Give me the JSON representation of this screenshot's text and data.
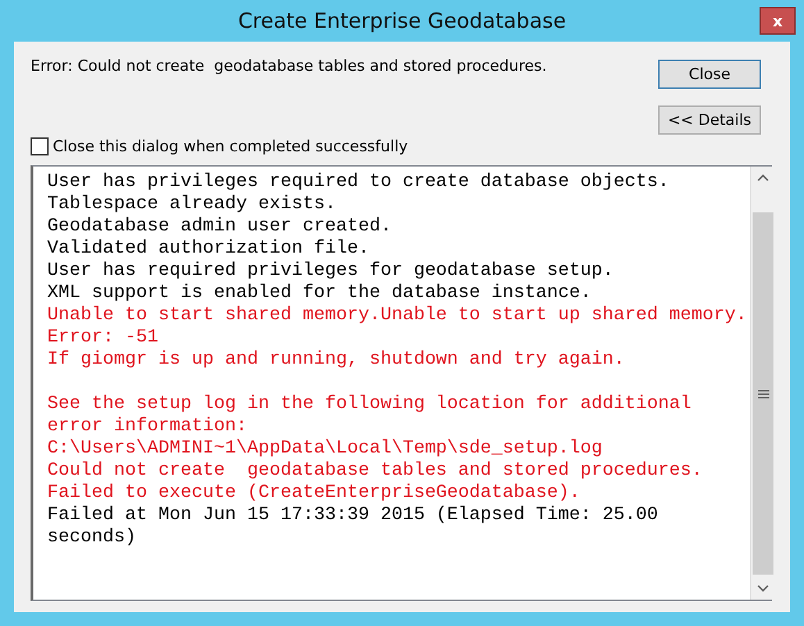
{
  "window": {
    "title": "Create Enterprise Geodatabase",
    "close_glyph": "x"
  },
  "message": "Error: Could not create  geodatabase tables and stored procedures.",
  "buttons": [
    {
      "label": "Close"
    },
    {
      "label": "<< Details"
    }
  ],
  "checkbox": {
    "label": "Close this dialog when completed successfully",
    "checked": false
  },
  "log": [
    {
      "lines": [
        {
          "kind": "info",
          "text": "User has privileges required to create database objects."
        },
        {
          "kind": "info",
          "text": "Tablespace already exists."
        },
        {
          "kind": "info",
          "text": "Geodatabase admin user created."
        },
        {
          "kind": "info",
          "text": "Validated authorization file."
        },
        {
          "kind": "info",
          "text": "User has required privileges for geodatabase setup."
        },
        {
          "kind": "info",
          "text": "XML support is enabled for the database instance."
        },
        {
          "kind": "error",
          "text": "Unable to start shared memory.Unable to start up shared memory."
        },
        {
          "kind": "error",
          "text": "Error: -51"
        },
        {
          "kind": "error",
          "text": "If giomgr is up and running, shutdown and try again."
        }
      ]
    },
    {
      "lines": [
        {
          "kind": "error",
          "text": "See the setup log in the following location for additional error information:"
        },
        {
          "kind": "error",
          "text": "C:\\Users\\ADMINI~1\\AppData\\Local\\Temp\\sde_setup.log"
        },
        {
          "kind": "error",
          "text": "Could not create  geodatabase tables and stored procedures."
        },
        {
          "kind": "error",
          "text": "Failed to execute (CreateEnterpriseGeodatabase)."
        },
        {
          "kind": "info",
          "text": "Failed at Mon Jun 15 17:33:39 2015 (Elapsed Time: 25.00 seconds)"
        }
      ]
    }
  ]
}
